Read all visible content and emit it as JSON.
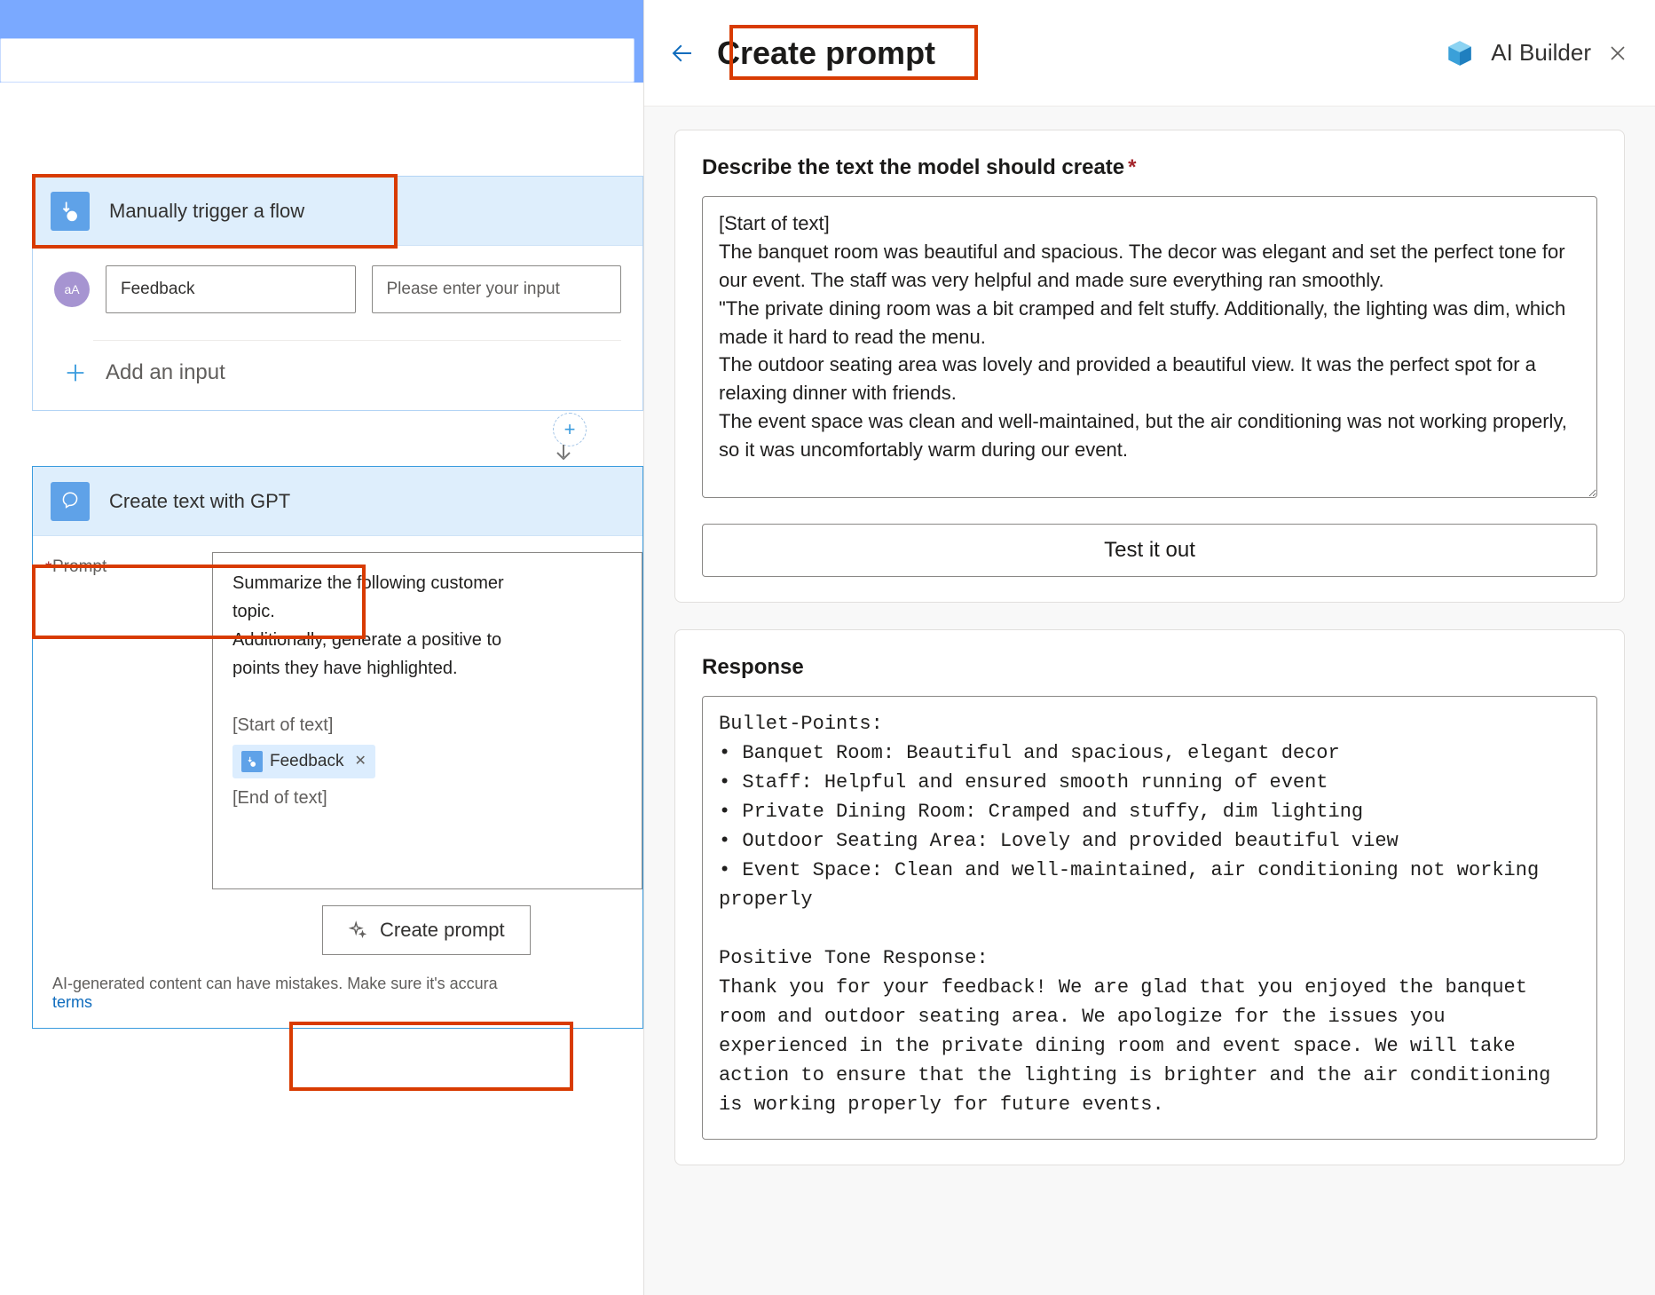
{
  "left": {
    "trigger": {
      "title": "Manually trigger a flow",
      "avatar_glyph": "aA",
      "field1": "Feedback",
      "field2_placeholder": "Please enter your input",
      "add_input_label": "Add an input"
    },
    "gpt": {
      "title": "Create text with GPT",
      "prompt_label": "Prompt",
      "prompt_text_line1": "Summarize the following customer ",
      "prompt_text_line2": "topic.",
      "prompt_text_line3": "Additionally, generate a positive to",
      "prompt_text_line4": "points they have highlighted.",
      "start_tag": "[Start of text]",
      "chip_label": "Feedback",
      "end_tag": "[End of text]",
      "create_prompt_btn": "Create prompt",
      "footer_note": "AI-generated content can have mistakes. Make sure it's accura",
      "footer_link": "terms"
    }
  },
  "right": {
    "title": "Create prompt",
    "brand": "AI Builder",
    "describe": {
      "label": "Describe the text the model should create",
      "value": "[Start of text]\nThe banquet room was beautiful and spacious. The decor was elegant and set the perfect tone for our event. The staff was very helpful and made sure everything ran smoothly.\n\"The private dining room was a bit cramped and felt stuffy. Additionally, the lighting was dim, which made it hard to read the menu.\nThe outdoor seating area was lovely and provided a beautiful view. It was the perfect spot for a relaxing dinner with friends.\nThe event space was clean and well-maintained, but the air conditioning was not working properly, so it was uncomfortably warm during our event."
    },
    "test_btn": "Test it out",
    "response_label": "Response",
    "response_text": "Bullet-Points:\n• Banquet Room: Beautiful and spacious, elegant decor\n• Staff: Helpful and ensured smooth running of event\n• Private Dining Room: Cramped and stuffy, dim lighting\n• Outdoor Seating Area: Lovely and provided beautiful view\n• Event Space: Clean and well-maintained, air conditioning not working properly\n\nPositive Tone Response:\nThank you for your feedback! We are glad that you enjoyed the banquet room and outdoor seating area. We apologize for the issues you experienced in the private dining room and event space. We will take action to ensure that the lighting is brighter and the air conditioning is working properly for future events."
  }
}
